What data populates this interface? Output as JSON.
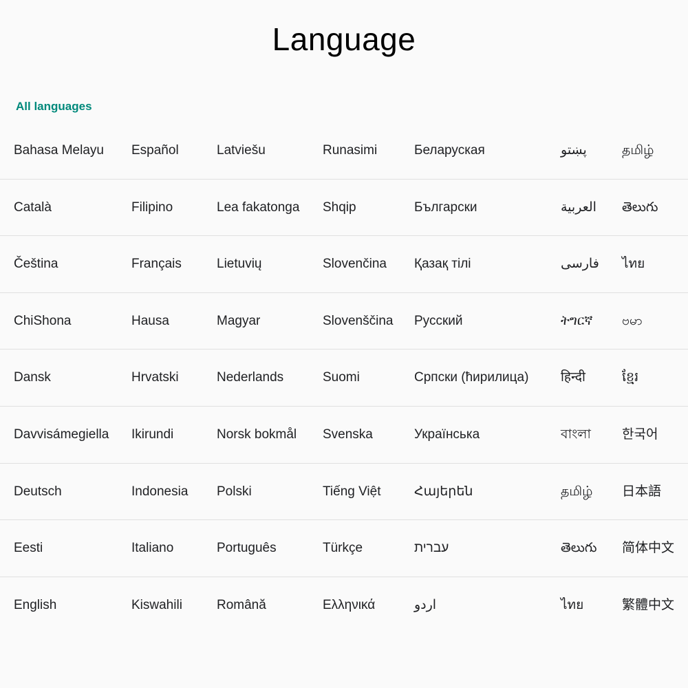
{
  "title": "Language",
  "section_header": "All languages",
  "rows": [
    [
      "Bahasa Melayu",
      "Español",
      "Latviešu",
      "Runasimi",
      "Беларуская",
      "پښتو",
      "தமிழ்"
    ],
    [
      "Català",
      "Filipino",
      "Lea fakatonga",
      "Shqip",
      "Български",
      "العربية",
      "తెలుగు"
    ],
    [
      "Čeština",
      "Français",
      "Lietuvių",
      "Slovenčina",
      "Қазақ тілі",
      "فارسی",
      "ไทย"
    ],
    [
      "ChiShona",
      "Hausa",
      "Magyar",
      "Slovenščina",
      "Русский",
      "ትግርኛ",
      "ဗမာ"
    ],
    [
      "Dansk",
      "Hrvatski",
      "Nederlands",
      "Suomi",
      "Српски (ћирилица)",
      "हिन्दी",
      "ខ្មែរ"
    ],
    [
      "Davvisámegiella",
      "Ikirundi",
      "Norsk bokmål",
      "Svenska",
      "Українська",
      "বাংলা",
      "한국어"
    ],
    [
      "Deutsch",
      "Indonesia",
      "Polski",
      "Tiếng Việt",
      "Հայերեն",
      "தமிழ்",
      "日本語"
    ],
    [
      "Eesti",
      "Italiano",
      "Português",
      "Türkçe",
      "עברית",
      "తెలుగు",
      "简体中文"
    ],
    [
      "English",
      "Kiswahili",
      "Română",
      "Ελληνικά",
      "اردو",
      "ไทย",
      "繁體中文"
    ]
  ]
}
